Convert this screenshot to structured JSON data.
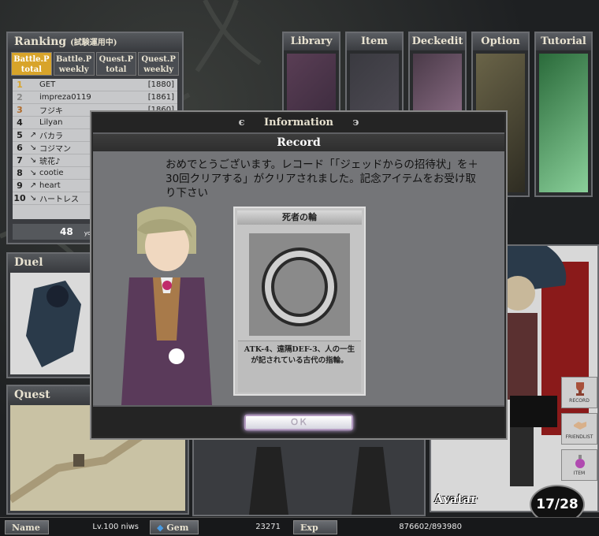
{
  "ranking": {
    "title": "Ranking",
    "title_note": "(試験運用中)",
    "tabs": [
      {
        "line1": "Battle.P",
        "line2": "total"
      },
      {
        "line1": "Battle.P",
        "line2": "weekly"
      },
      {
        "line1": "Quest.P",
        "line2": "total"
      },
      {
        "line1": "Quest.P",
        "line2": "weekly"
      }
    ],
    "rows": [
      {
        "rank": "1",
        "trend": "",
        "name": "GET",
        "points": "[1880]"
      },
      {
        "rank": "2",
        "trend": "",
        "name": "impreza0119",
        "points": "[1861]"
      },
      {
        "rank": "3",
        "trend": "",
        "name": "フジキ",
        "points": "[1860]"
      },
      {
        "rank": "4",
        "trend": "",
        "name": "Lilyan",
        "points": ""
      },
      {
        "rank": "5",
        "trend": "↗",
        "name": "バカラ",
        "points": ""
      },
      {
        "rank": "6",
        "trend": "↘",
        "name": "コジマン",
        "points": ""
      },
      {
        "rank": "7",
        "trend": "↘",
        "name": "琥花♪",
        "points": ""
      },
      {
        "rank": "8",
        "trend": "↘",
        "name": "cootie",
        "points": ""
      },
      {
        "rank": "9",
        "trend": "↗",
        "name": "heart",
        "points": ""
      },
      {
        "rank": "10",
        "trend": "↘",
        "name": "ハートレス",
        "points": ""
      }
    ],
    "footer_value": "48",
    "footer_note": "your"
  },
  "menu": {
    "library": "Library",
    "item": "Item",
    "deckedit": "Deckedit",
    "option": "Option",
    "tutorial": "Tutorial"
  },
  "duel": {
    "title": "Duel"
  },
  "quest": {
    "title": "Quest"
  },
  "avatar": {
    "title": "Avatar",
    "side_record": "RECORD",
    "side_friendlist": "FRIENDLIST",
    "side_item": "ITEM",
    "ap": "17/28"
  },
  "modal": {
    "header": "Information",
    "subtitle": "Record",
    "message": "おめでとうございます。レコード「「ジェッドからの招待状」を＋30回クリアする」がクリアされました。記念アイテムをお受け取り下さい",
    "item_name": "死者の輪",
    "item_desc": "ATK-4、遠隔DEF-3、人の一生が記されている古代の指輪。",
    "ok_label": "ＯＫ"
  },
  "status": {
    "name_label": "Name",
    "name_value": "Lv.100 niws",
    "gem_label": "Gem",
    "gem_value": "23271",
    "exp_label": "Exp",
    "exp_value": "876602/893980"
  }
}
